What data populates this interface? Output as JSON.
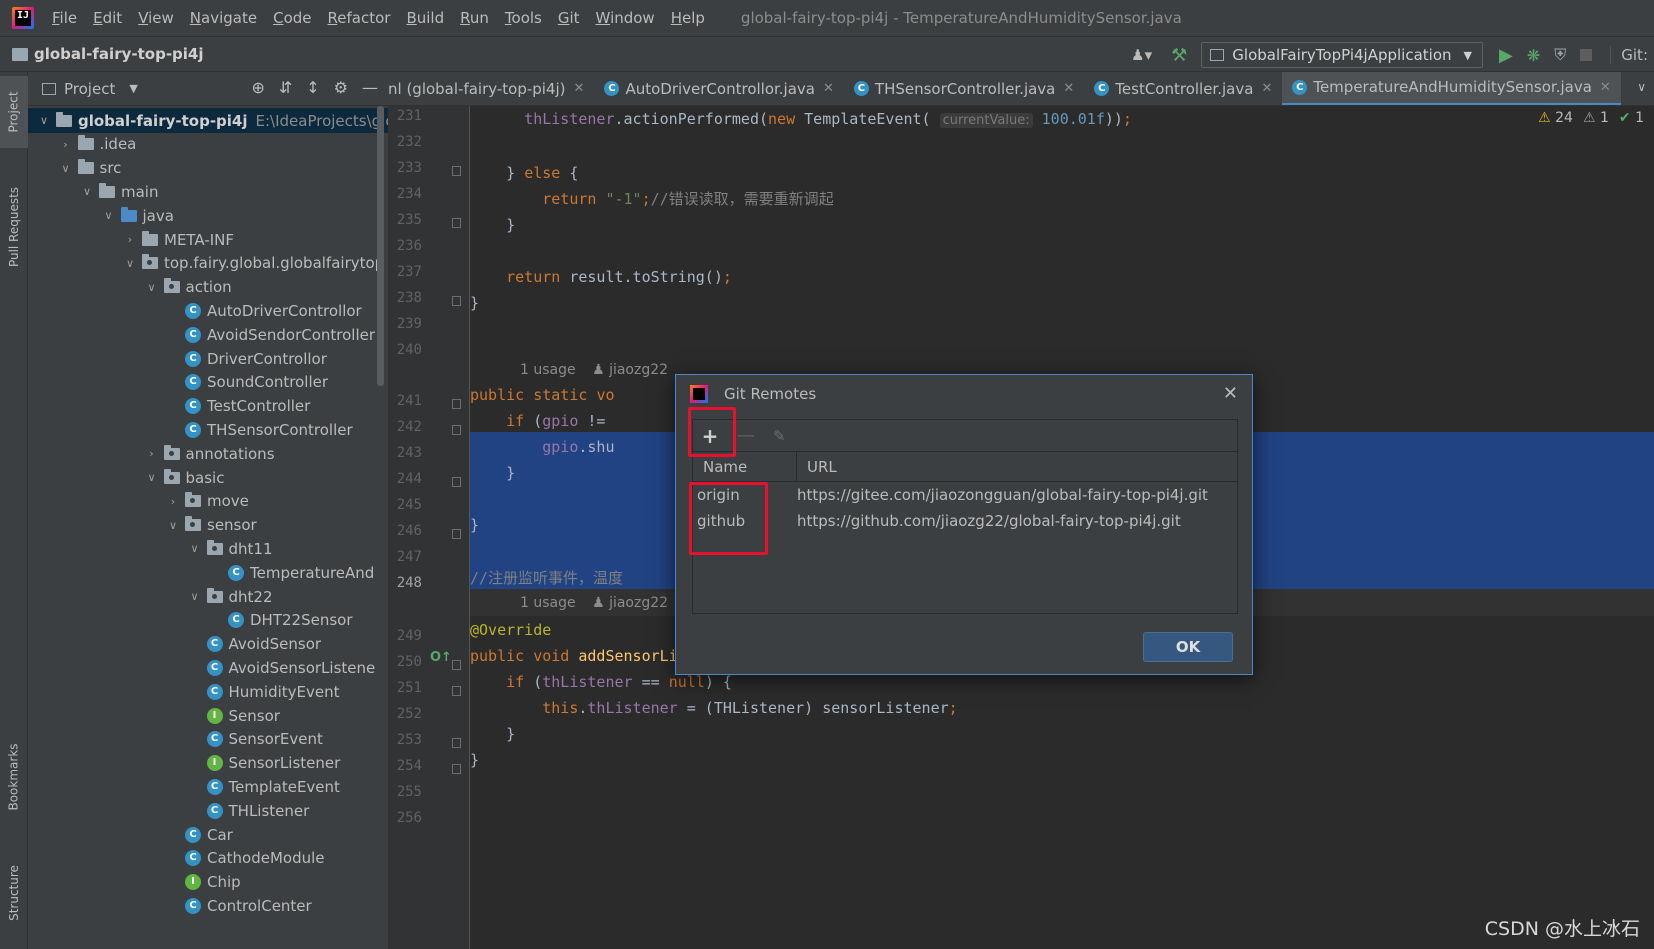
{
  "app": {
    "logo_text": "IJ",
    "menu": [
      "File",
      "Edit",
      "View",
      "Navigate",
      "Code",
      "Refactor",
      "Build",
      "Run",
      "Tools",
      "Git",
      "Window",
      "Help"
    ],
    "window_title": "global-fairy-top-pi4j - TemperatureAndHumiditySensor.java"
  },
  "navbar": {
    "project_name": "global-fairy-top-pi4j",
    "run_config": "GlobalFairyTopPi4jApplication",
    "git_label": "Git:"
  },
  "tool_strip": {
    "project": "Project",
    "pull_requests": "Pull Requests",
    "bookmarks": "Bookmarks",
    "structure": "Structure"
  },
  "project_panel": {
    "title": "Project",
    "tree": [
      {
        "label": "global-fairy-top-pi4j",
        "hint": "E:\\IdeaProjects\\glob",
        "kind": "module",
        "level": 0,
        "arrow": "v",
        "bold": true
      },
      {
        "label": ".idea",
        "kind": "folder",
        "level": 1,
        "arrow": ">"
      },
      {
        "label": "src",
        "kind": "folder",
        "level": 1,
        "arrow": "v"
      },
      {
        "label": "main",
        "kind": "folder",
        "level": 2,
        "arrow": "v"
      },
      {
        "label": "java",
        "kind": "src",
        "level": 3,
        "arrow": "v"
      },
      {
        "label": "META-INF",
        "kind": "folder",
        "level": 4,
        "arrow": ">"
      },
      {
        "label": "top.fairy.global.globalfairytop",
        "kind": "pkg",
        "level": 4,
        "arrow": "v"
      },
      {
        "label": "action",
        "kind": "pkg",
        "level": 5,
        "arrow": "v"
      },
      {
        "label": "AutoDriverControllor",
        "kind": "class",
        "level": 6
      },
      {
        "label": "AvoidSendorController",
        "kind": "class",
        "level": 6
      },
      {
        "label": "DriverControllor",
        "kind": "class",
        "level": 6
      },
      {
        "label": "SoundController",
        "kind": "class",
        "level": 6
      },
      {
        "label": "TestController",
        "kind": "class",
        "level": 6
      },
      {
        "label": "THSensorController",
        "kind": "class",
        "level": 6
      },
      {
        "label": "annotations",
        "kind": "pkg",
        "level": 5,
        "arrow": ">"
      },
      {
        "label": "basic",
        "kind": "pkg",
        "level": 5,
        "arrow": "v"
      },
      {
        "label": "move",
        "kind": "pkg",
        "level": 6,
        "arrow": ">"
      },
      {
        "label": "sensor",
        "kind": "pkg",
        "level": 6,
        "arrow": "v"
      },
      {
        "label": "dht11",
        "kind": "pkg",
        "level": 7,
        "arrow": "v"
      },
      {
        "label": "TemperatureAnd",
        "kind": "class",
        "level": 8
      },
      {
        "label": "dht22",
        "kind": "pkg",
        "level": 7,
        "arrow": "v"
      },
      {
        "label": "DHT22Sensor",
        "kind": "class",
        "level": 8
      },
      {
        "label": "AvoidSensor",
        "kind": "class",
        "level": 7
      },
      {
        "label": "AvoidSensorListene",
        "kind": "class",
        "level": 7
      },
      {
        "label": "HumidityEvent",
        "kind": "class",
        "level": 7
      },
      {
        "label": "Sensor",
        "kind": "iface",
        "level": 7
      },
      {
        "label": "SensorEvent",
        "kind": "class",
        "level": 7
      },
      {
        "label": "SensorListener",
        "kind": "iface",
        "level": 7
      },
      {
        "label": "TemplateEvent",
        "kind": "class",
        "level": 7
      },
      {
        "label": "THListener",
        "kind": "class",
        "level": 7
      },
      {
        "label": "Car",
        "kind": "class",
        "level": 6
      },
      {
        "label": "CathodeModule",
        "kind": "class",
        "level": 6
      },
      {
        "label": "Chip",
        "kind": "iface",
        "level": 6
      },
      {
        "label": "ControlCenter",
        "kind": "class",
        "level": 6
      }
    ]
  },
  "editor_tabs": [
    {
      "label": "nl (global-fairy-top-pi4j)",
      "icon": false,
      "active": false
    },
    {
      "label": "AutoDriverControllor.java",
      "icon": true,
      "active": false
    },
    {
      "label": "THSensorController.java",
      "icon": true,
      "active": false
    },
    {
      "label": "TestController.java",
      "icon": true,
      "active": false
    },
    {
      "label": "TemperatureAndHumiditySensor.java",
      "icon": true,
      "active": true
    }
  ],
  "inspections": {
    "warnings": "24",
    "weak_warnings": "1",
    "ok": "1"
  },
  "editor": {
    "line_numbers": [
      "231",
      "232",
      "233",
      "234",
      "235",
      "236",
      "237",
      "238",
      "239",
      "240",
      "",
      "241",
      "242",
      "243",
      "244",
      "245",
      "246",
      "247",
      "248",
      "",
      "249",
      "250",
      "251",
      "252",
      "253",
      "254",
      "255",
      "256"
    ],
    "current_line": "248",
    "usage_1": "1 usage",
    "author_1": "jiaozg22",
    "usage_2": "1 usage",
    "author_2": "jiaozg22",
    "hint_current_value": "currentValue:"
  },
  "dialog": {
    "title": "Git Remotes",
    "columns": {
      "name": "Name",
      "url": "URL"
    },
    "remotes": [
      {
        "name": "origin",
        "url": "https://gitee.com/jiaozongguan/global-fairy-top-pi4j.git"
      },
      {
        "name": "github",
        "url": "https://github.com/jiaozg22/global-fairy-top-pi4j.git"
      }
    ],
    "ok_label": "OK"
  },
  "watermark": "CSDN @水上冰石"
}
